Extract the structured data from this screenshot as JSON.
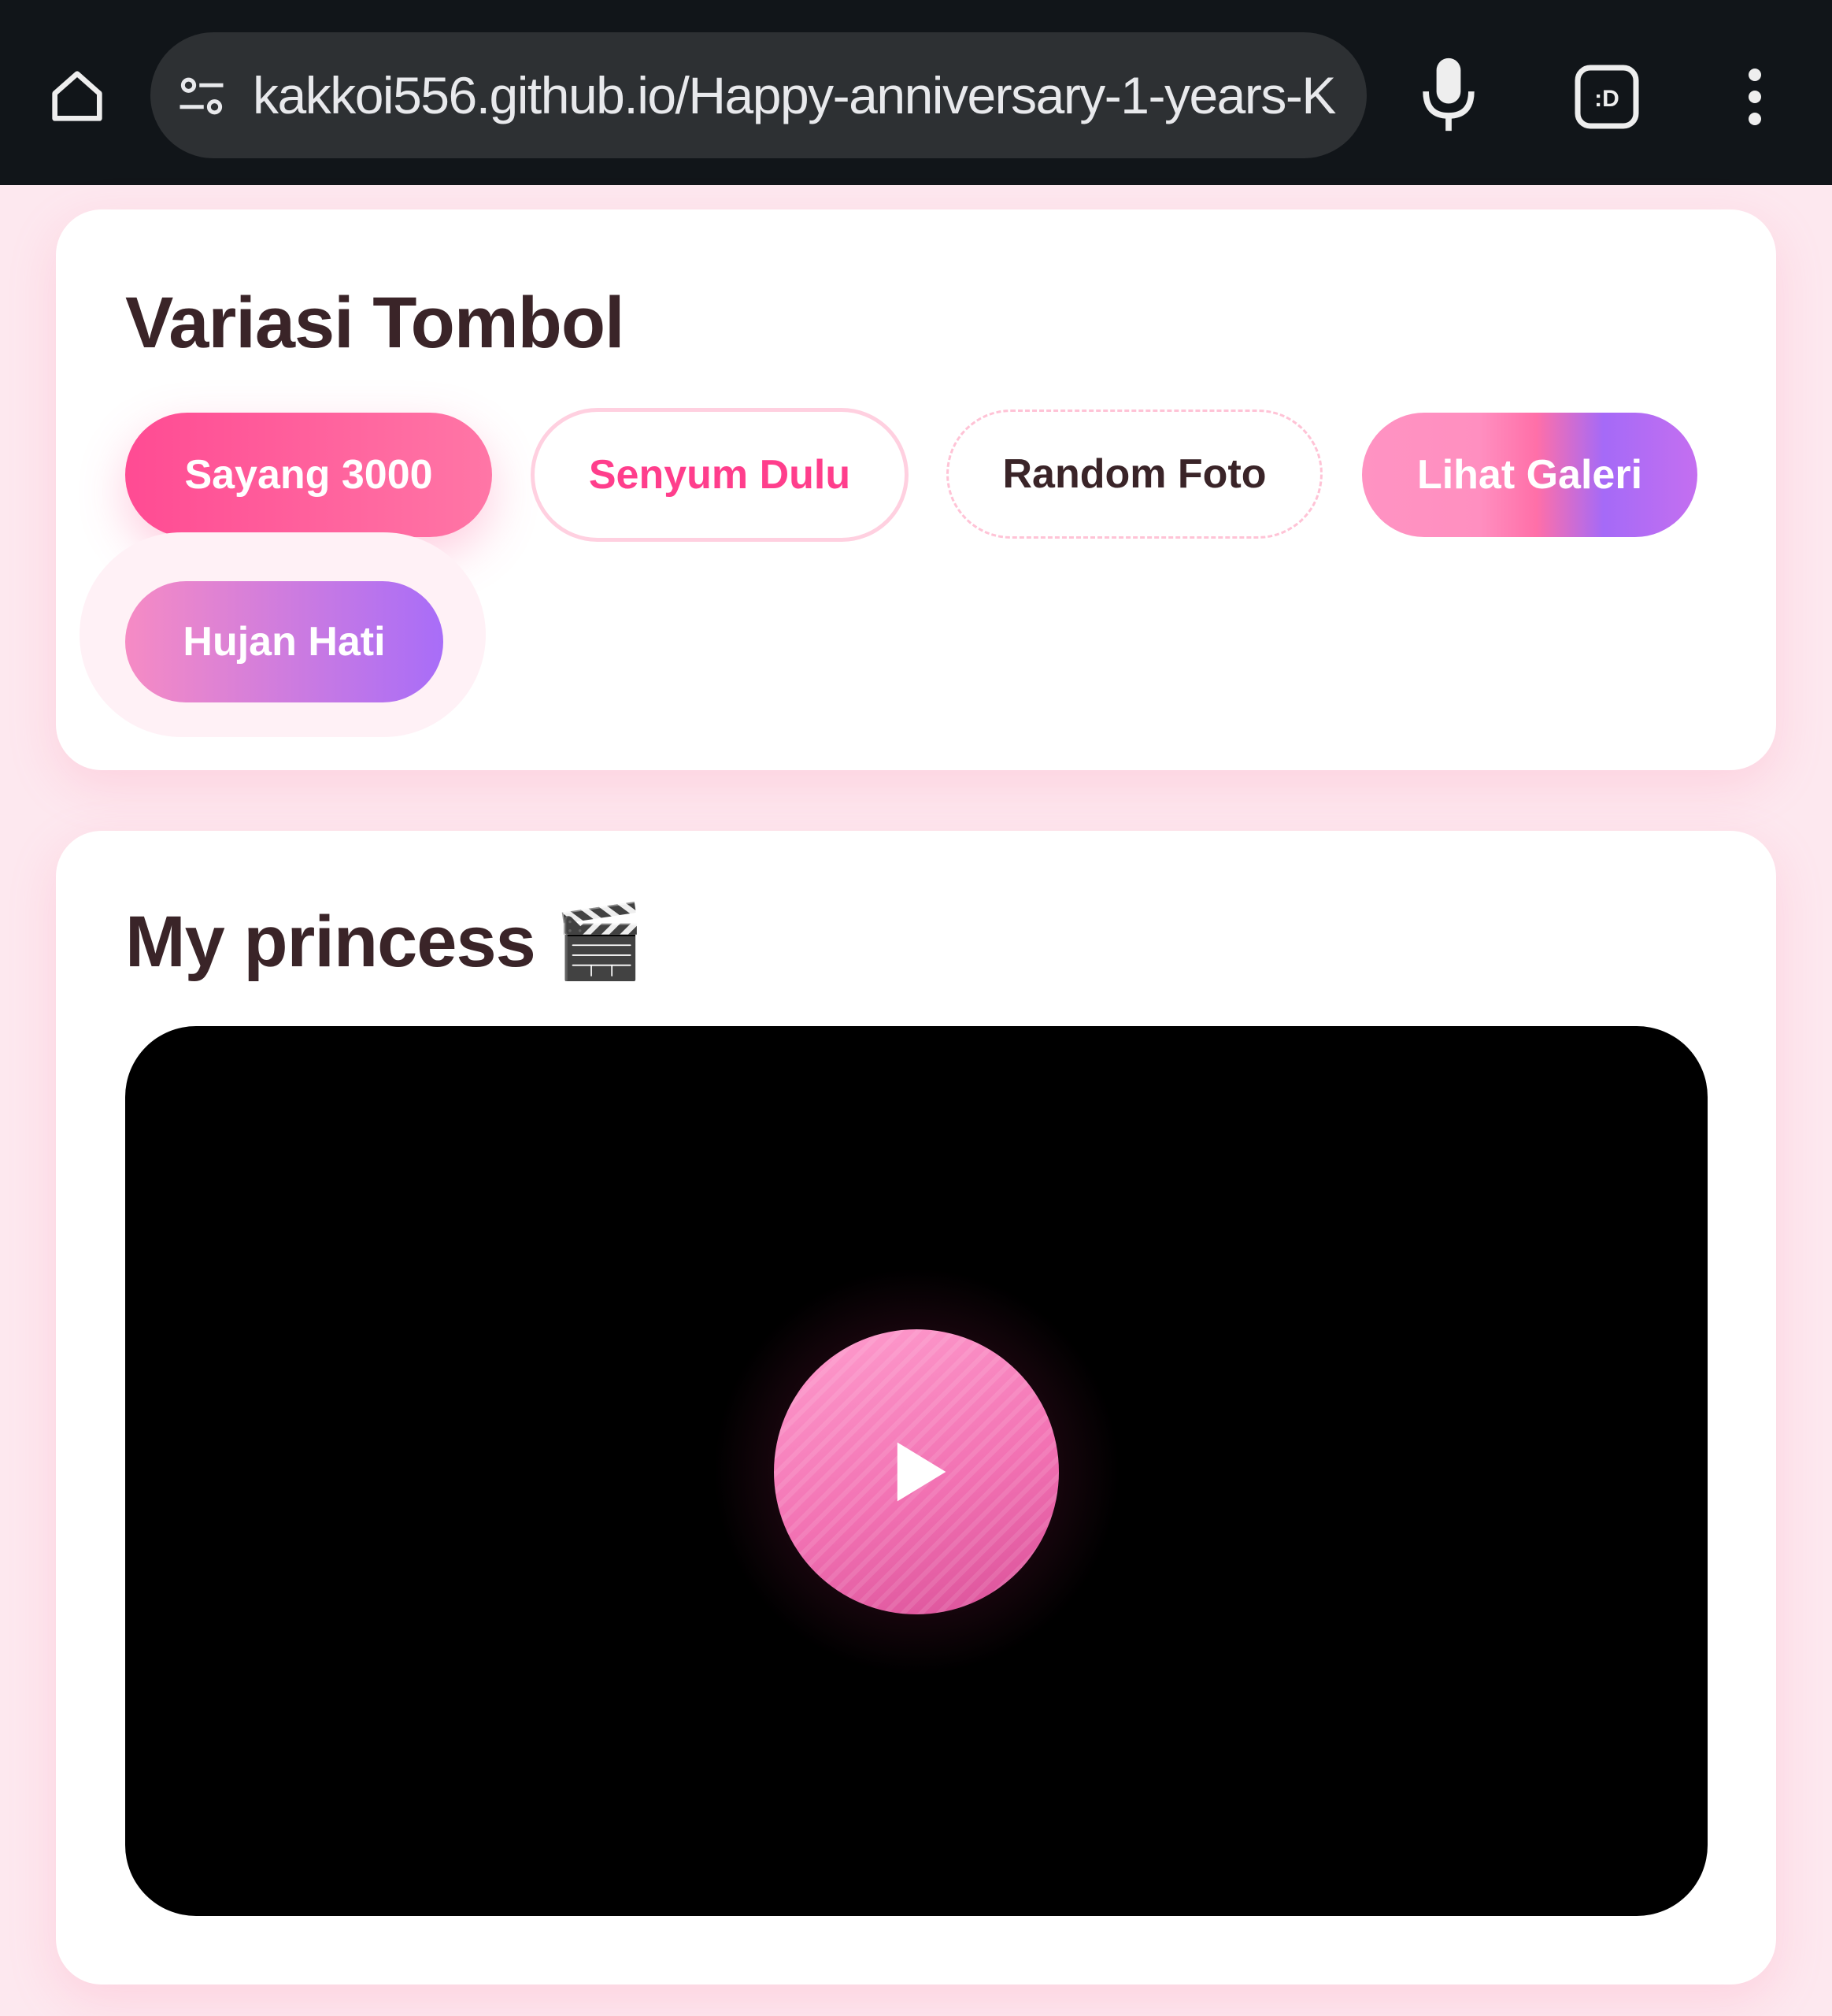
{
  "browser": {
    "url": "kakkoi556.github.io/Happy-anniversary-1-years-K",
    "tab_switcher_label": ":D"
  },
  "buttons_card": {
    "title": "Variasi Tombol",
    "buttons": [
      {
        "label": "Sayang 3000"
      },
      {
        "label": "Senyum Dulu"
      },
      {
        "label": "Random Foto"
      },
      {
        "label": "Lihat Galeri"
      },
      {
        "label": "Hujan Hati"
      }
    ]
  },
  "video_card": {
    "title": "My princess 🎬"
  },
  "colors": {
    "page_bg": "#fde8ef",
    "chrome_bg": "#111519",
    "accent_pink": "#ff4b93",
    "accent_purple": "#a86df8",
    "title_text": "#3a2428"
  },
  "icons": [
    "home-icon",
    "site-settings-icon",
    "mic-icon",
    "tab-switcher-icon",
    "more-vert-icon",
    "play-icon"
  ]
}
